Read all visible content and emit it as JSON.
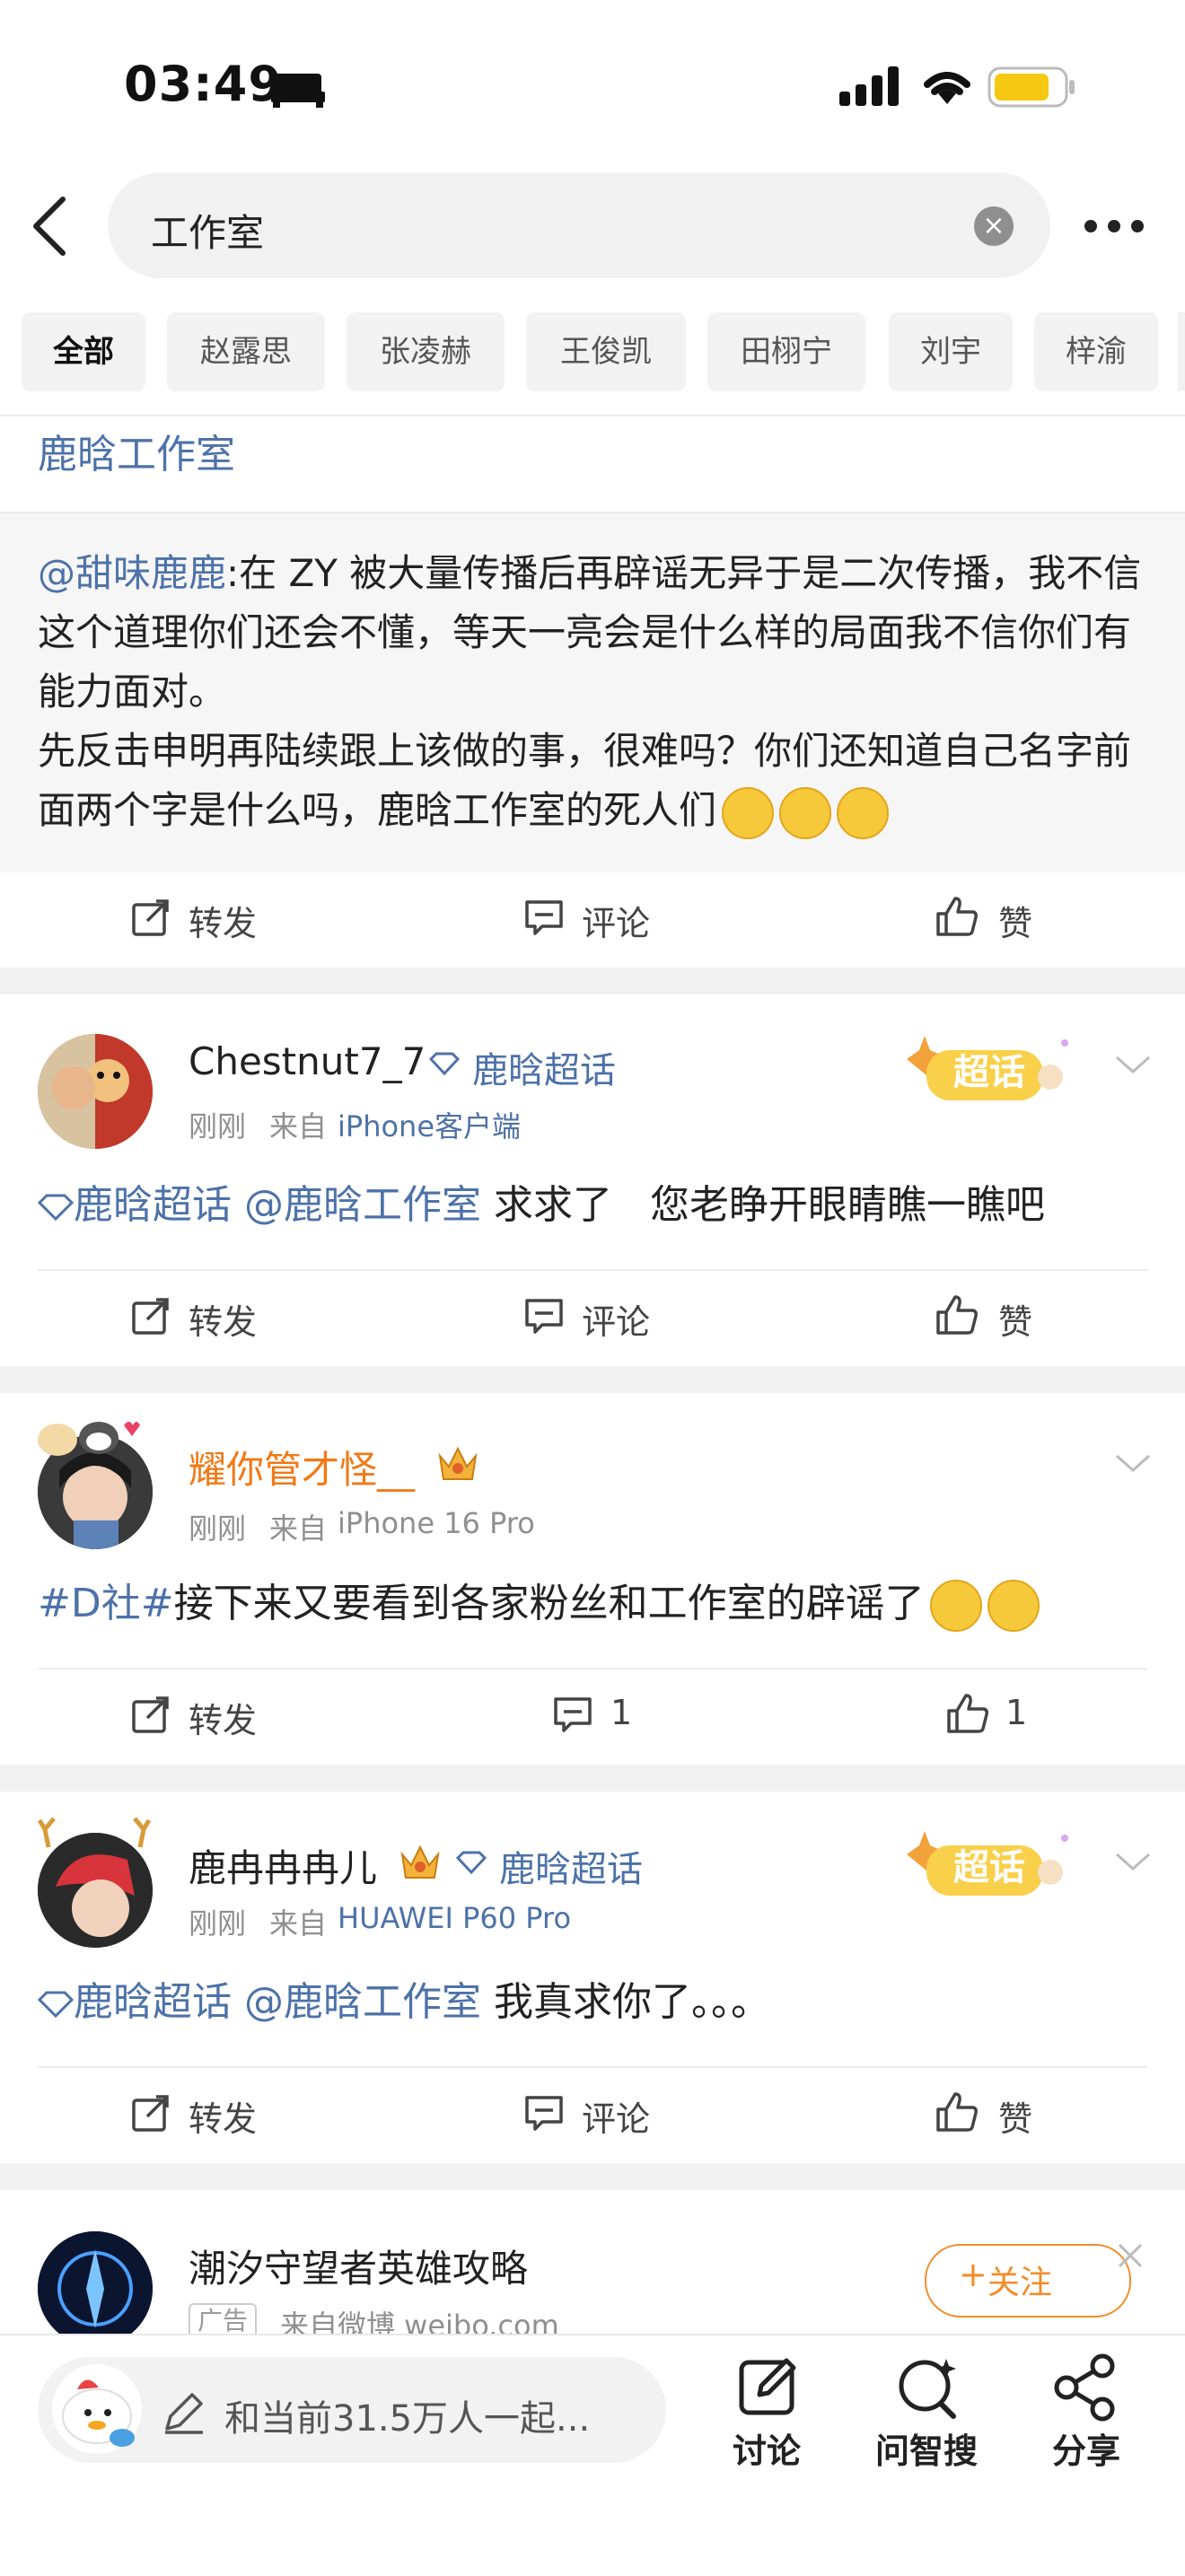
{
  "status_bar": {
    "time": "03:49"
  },
  "search": {
    "query": "工作室"
  },
  "tabs": [
    "全部",
    "赵露思",
    "张凌赫",
    "王俊凯",
    "田栩宁",
    "刘宇",
    "梓渝"
  ],
  "post0": {
    "author": "鹿晗工作室",
    "repost_mention": "@甜味鹿鹿",
    "repost_text": ":在 ZY 被大量传播后再辟谣无异于是二次传播，我不信这个道理你们还会不懂，等天一亮会是什么样的局面我不信你们有能力面对。",
    "repost_text2": "先反击申明再陆续跟上该做的事，很难吗？你们还知道自己名字前面两个字是什么吗，鹿晗工作室的死人们",
    "repost": "转发",
    "comment": "评论",
    "like": "赞"
  },
  "post1": {
    "username": "Chestnut7_7",
    "tag": "鹿晗超话",
    "time": "刚刚",
    "source_prefix": "来自",
    "source": "iPhone客户端",
    "badge": "超话",
    "text_tag": "鹿晗超话",
    "text_mention": "@鹿晗工作室",
    "text_body": " 求求了   您老睁开眼睛瞧一瞧吧",
    "repost": "转发",
    "comment": "评论",
    "like": "赞"
  },
  "post2": {
    "username": "耀你管才怪__",
    "time": "刚刚",
    "source_prefix": "来自",
    "source": "iPhone 16 Pro",
    "text_hashtag": "#D社#",
    "text_body": "接下来又要看到各家粉丝和工作室的辟谣了",
    "repost": "转发",
    "comment_count": "1",
    "like_count": "1"
  },
  "post3": {
    "username": "鹿冉冉冉儿",
    "tag": "鹿晗超话",
    "time": "刚刚",
    "source_prefix": "来自",
    "source": "HUAWEI P60 Pro",
    "badge": "超话",
    "text_tag": "鹿晗超话",
    "text_mention": "@鹿晗工作室",
    "text_body": " 我真求你了。。。",
    "repost": "转发",
    "comment": "评论",
    "like": "赞"
  },
  "ad": {
    "name": "潮汐守望者英雄攻略",
    "ad_label": "广告",
    "source": "来自微博 weibo.com",
    "follow": "关注"
  },
  "bottom": {
    "compose_placeholder": "和当前31.5万人一起...",
    "discuss": "讨论",
    "ask": "问智搜",
    "share": "分享"
  },
  "colors": {
    "link_blue": "#4d72a8",
    "orange_name": "#f07a18",
    "gold": "#f6c93a"
  }
}
